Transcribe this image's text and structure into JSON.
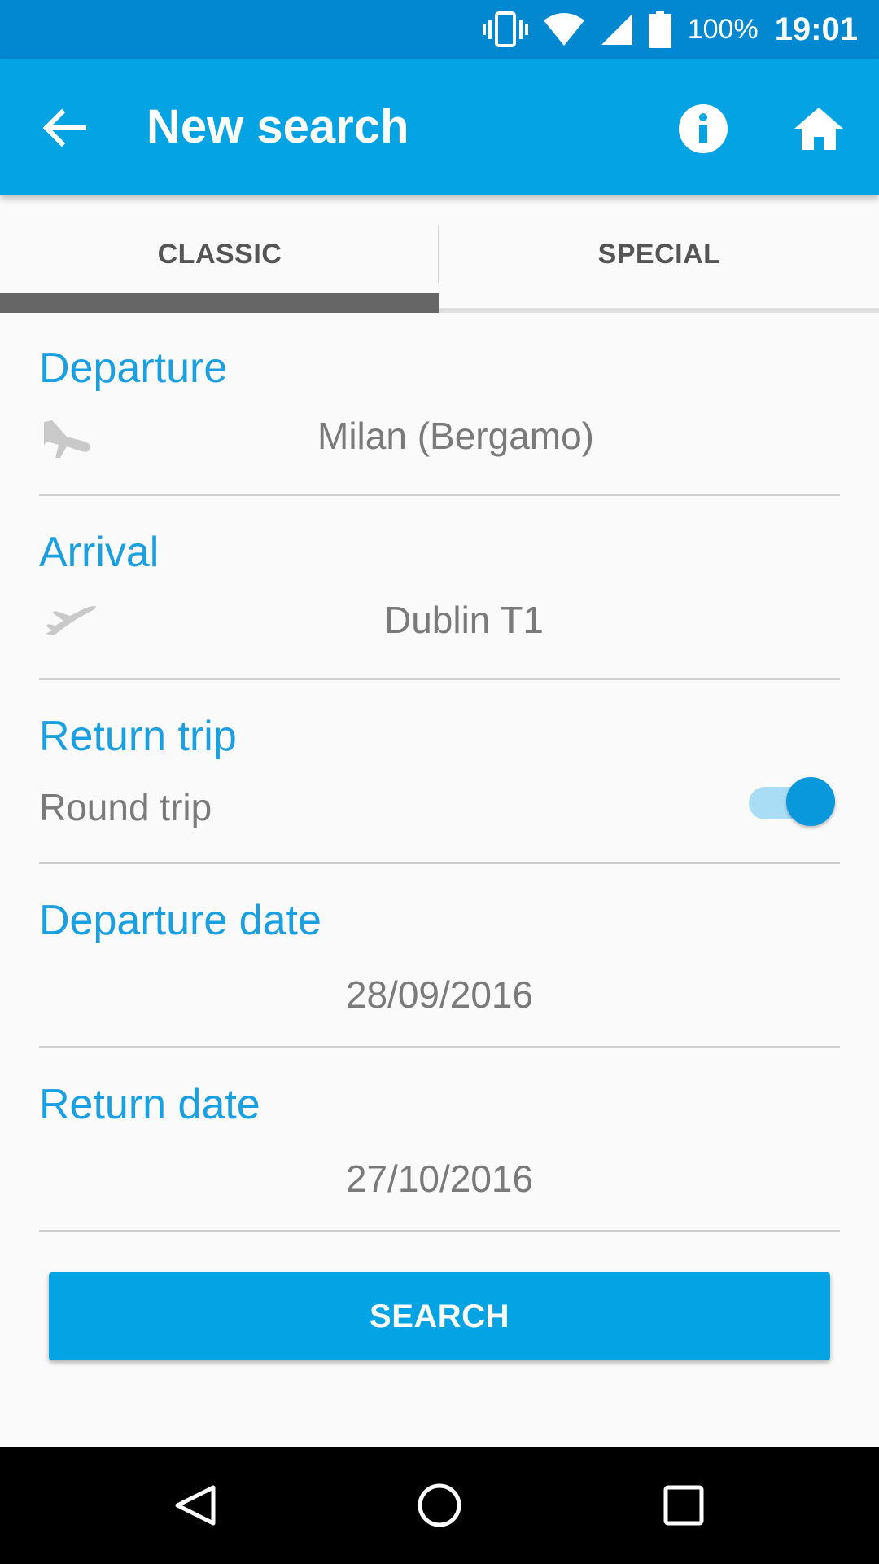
{
  "status_bar": {
    "battery_percent": "100%",
    "time": "19:01",
    "icons": [
      "vibrate-icon",
      "wifi-icon",
      "cell-signal-icon",
      "battery-icon"
    ]
  },
  "app_bar": {
    "title": "New search",
    "back_icon": "arrow-back-icon",
    "info_icon": "info-icon",
    "home_icon": "home-icon"
  },
  "tabs": [
    {
      "label": "CLASSIC",
      "selected": true
    },
    {
      "label": "SPECIAL",
      "selected": false
    }
  ],
  "form": {
    "departure": {
      "label": "Departure",
      "value": "Milan (Bergamo)",
      "icon": "plane-departure-icon"
    },
    "arrival": {
      "label": "Arrival",
      "value": "Dublin T1",
      "icon": "plane-arrival-icon"
    },
    "return_trip": {
      "label": "Return trip",
      "option_label": "Round trip",
      "enabled": true
    },
    "departure_date": {
      "label": "Departure date",
      "value": "28/09/2016"
    },
    "return_date": {
      "label": "Return date",
      "value": "27/10/2016"
    }
  },
  "search_button": {
    "label": "SEARCH"
  },
  "nav_bar": {
    "icons": [
      "nav-back-icon",
      "nav-home-icon",
      "nav-recents-icon"
    ]
  },
  "colors": {
    "status_bar": "#0288d1",
    "app_bar": "#03a3e4",
    "accent": "#1a9fe0",
    "toggle_thumb": "#0a98dd",
    "toggle_track": "#a9ddf6"
  }
}
